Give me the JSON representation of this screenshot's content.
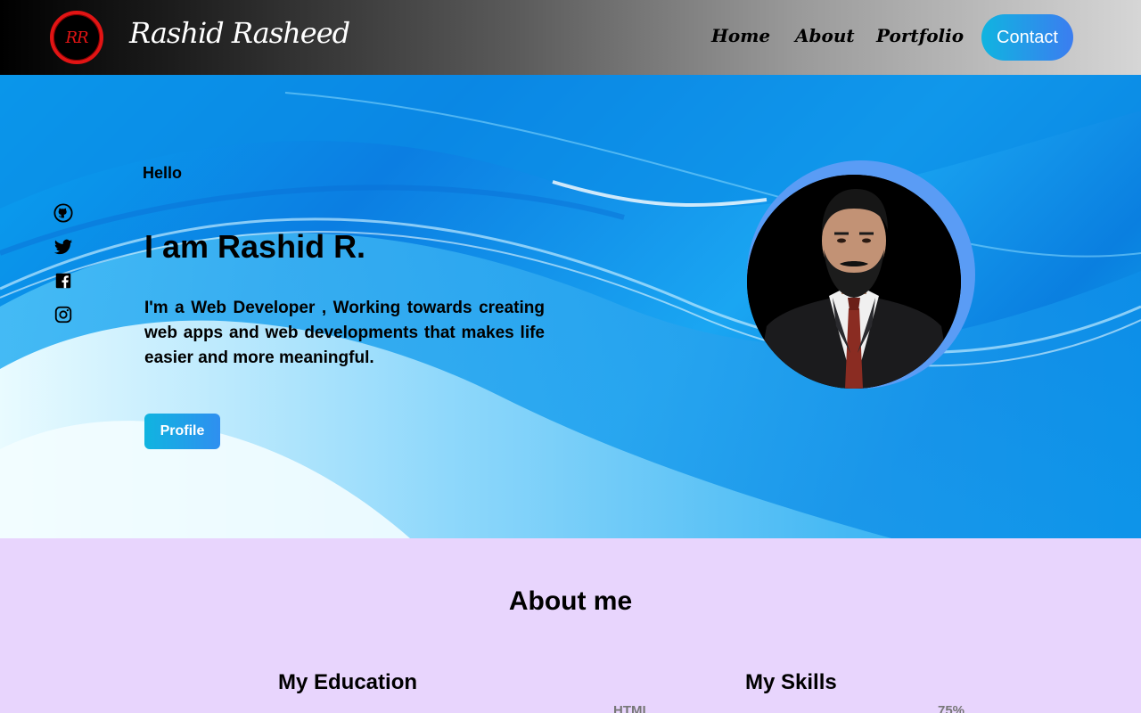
{
  "header": {
    "logo_text": "RR",
    "brand": "Rashid Rasheed",
    "nav": {
      "home": "Home",
      "about": "About",
      "portfolio": "Portfolio"
    },
    "contact_label": "Contact"
  },
  "hero": {
    "greeting": "Hello",
    "title": "I am Rashid R.",
    "description": "I'm a Web Developer , Working towards creating web apps and web developments that makes life easier and more meaningful.",
    "profile_label": "Profile",
    "social_icons": [
      "github-icon",
      "twitter-icon",
      "facebook-icon",
      "instagram-icon"
    ]
  },
  "about": {
    "title": "About me",
    "education_title": "My Education",
    "skills_title": "My Skills",
    "skills": [
      {
        "name": "HTML",
        "percent_label": "75%"
      }
    ]
  },
  "colors": {
    "accent_start": "#10b4e0",
    "accent_end": "#3b7df0",
    "about_bg": "#e8d5fd",
    "logo_red": "#e21414"
  }
}
